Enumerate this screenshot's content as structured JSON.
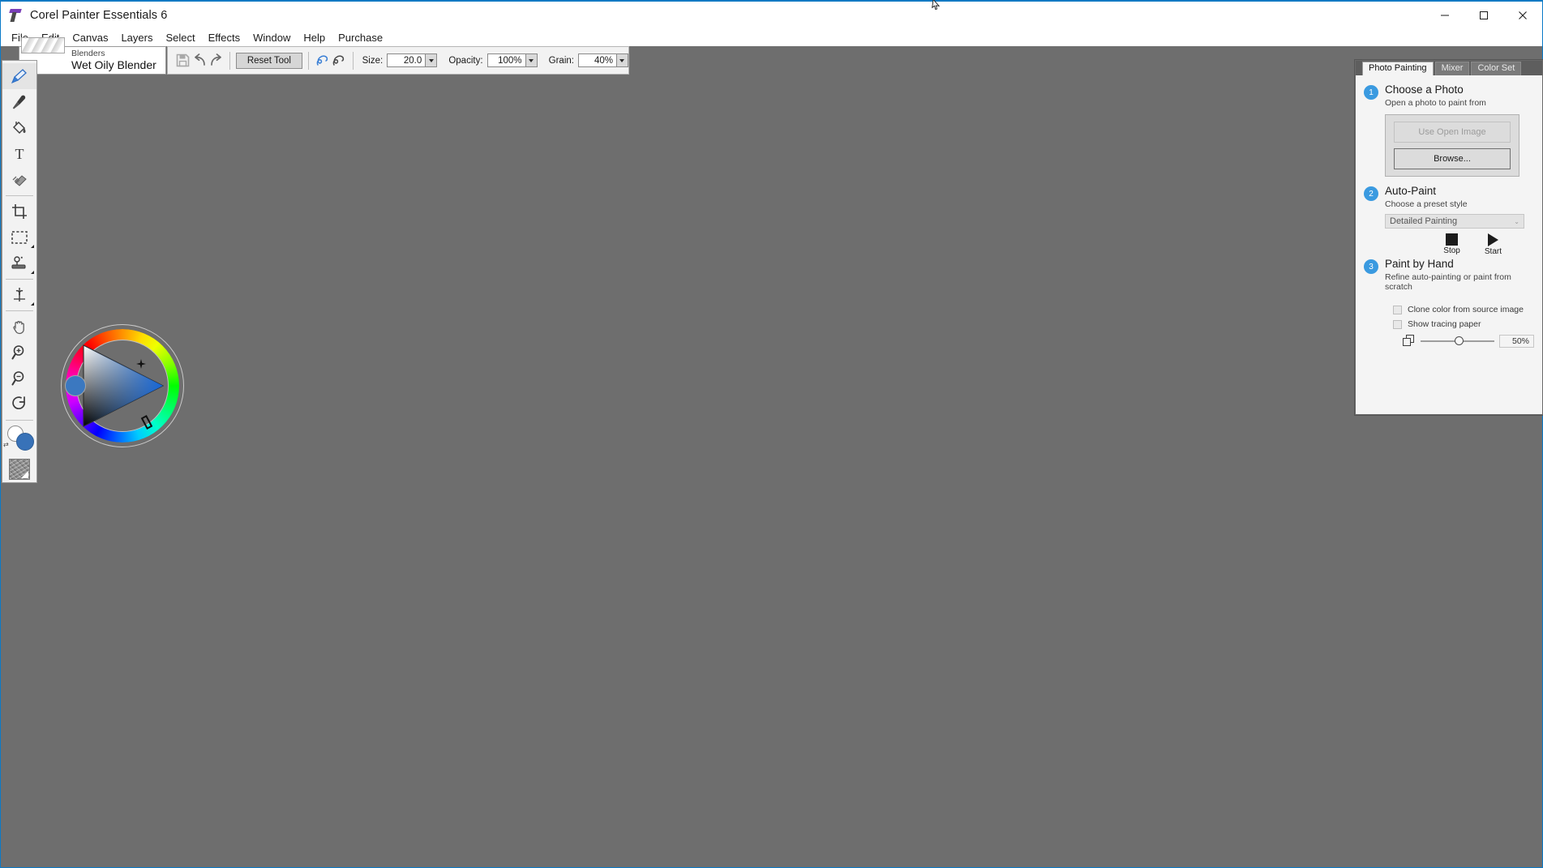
{
  "window": {
    "title": "Corel Painter Essentials 6",
    "app_icon": "corel-painter-icon",
    "minimize": "—",
    "maximize": "☐",
    "close": "✕"
  },
  "menubar": {
    "items": [
      {
        "label": "File"
      },
      {
        "label": "Edit"
      },
      {
        "label": "Canvas"
      },
      {
        "label": "Layers"
      },
      {
        "label": "Select"
      },
      {
        "label": "Effects"
      },
      {
        "label": "Window"
      },
      {
        "label": "Help"
      },
      {
        "label": "Purchase"
      }
    ]
  },
  "brush_selector": {
    "category": "Blenders",
    "name": "Wet Oily Blender"
  },
  "property_bar": {
    "save_icon": "save-icon",
    "undo_icon": "undo-icon",
    "redo_icon": "redo-icon",
    "reset_tool_label": "Reset Tool",
    "stroke_icon": "record-stroke-icon",
    "playback_icon": "playback-stroke-icon",
    "size": {
      "label": "Size:",
      "value": "20.0"
    },
    "opacity": {
      "label": "Opacity:",
      "value": "100%"
    },
    "grain": {
      "label": "Grain:",
      "value": "40%"
    }
  },
  "toolbox": {
    "tools": [
      {
        "name": "brush-tool",
        "active": true
      },
      {
        "name": "dropper-tool",
        "active": false
      },
      {
        "name": "paint-bucket-tool",
        "active": false
      },
      {
        "name": "text-tool",
        "active": false
      },
      {
        "name": "eraser-tool",
        "active": false
      },
      {
        "name": "crop-tool",
        "active": false
      },
      {
        "name": "rectangular-selection-tool",
        "active": false
      },
      {
        "name": "cloner-tool",
        "active": false
      },
      {
        "name": "transform-tool",
        "active": false
      },
      {
        "name": "grabber-hand-tool",
        "active": false
      },
      {
        "name": "magnifier-zoom-in-tool",
        "active": false
      },
      {
        "name": "magnifier-zoom-out-tool",
        "active": false
      },
      {
        "name": "rotate-page-tool",
        "active": false
      }
    ],
    "colors": {
      "main_color": "#3872b8",
      "additional_color": "#ffffff",
      "paper_swatch": "paper-texture-swatch"
    }
  },
  "color_wheel": {
    "name": "color-wheel",
    "selected_color": "#3b78c0",
    "hue_marker": "hue-ring-marker",
    "saturation_value_marker": "triangle-crosshair-marker"
  },
  "right_panel": {
    "tabs": [
      {
        "label": "Photo Painting",
        "active": true
      },
      {
        "label": "Mixer",
        "active": false
      },
      {
        "label": "Color Set",
        "active": false
      }
    ],
    "step1": {
      "number": "1",
      "title": "Choose a Photo",
      "subtitle": "Open a photo to paint from",
      "use_open_image_label": "Use Open Image",
      "browse_label": "Browse..."
    },
    "step2": {
      "number": "2",
      "title": "Auto-Paint",
      "subtitle": "Choose a preset style",
      "preset_value": "Detailed Painting",
      "stop_label": "Stop",
      "start_label": "Start"
    },
    "step3": {
      "number": "3",
      "title": "Paint by Hand",
      "subtitle": "Refine auto-painting or paint from scratch",
      "clone_color_label": "Clone color from source image",
      "show_tracing_paper_label": "Show tracing paper",
      "tracing_opacity": "50%"
    },
    "accent_color": "#3a9ae0"
  },
  "canvas": {
    "background_color": "#6e6e6e"
  }
}
